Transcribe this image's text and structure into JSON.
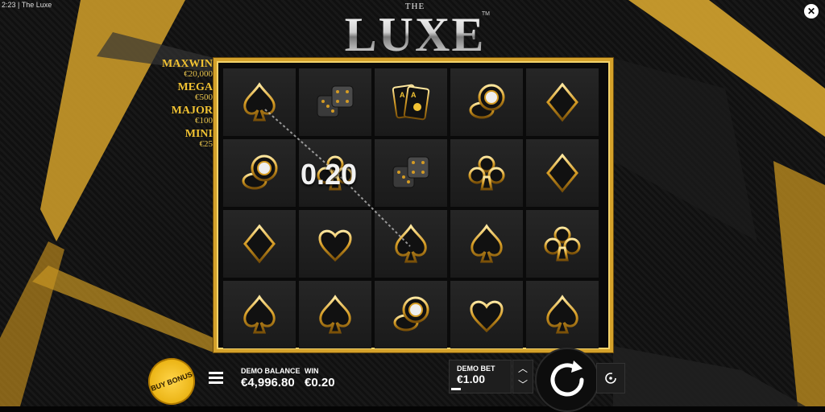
{
  "window": {
    "time": "2:23",
    "title": "The Luxe"
  },
  "logo": {
    "the": "THE",
    "name": "LUXE",
    "tm": "TM"
  },
  "jackpots": [
    {
      "name": "MAXWIN",
      "value": "€20,000"
    },
    {
      "name": "MEGA",
      "value": "€500"
    },
    {
      "name": "MAJOR",
      "value": "€100"
    },
    {
      "name": "MINI",
      "value": "€25"
    }
  ],
  "reels": [
    [
      "spade-icon",
      "dice-icon",
      "aces-cards-icon",
      "chips-icon",
      "diamond-icon"
    ],
    [
      "chips-icon",
      "club-icon",
      "dice-icon",
      "club-icon",
      "diamond-icon"
    ],
    [
      "diamond-icon",
      "heart-icon",
      "spade-icon",
      "spade-icon",
      "club-icon"
    ],
    [
      "spade-icon",
      "spade-icon",
      "chips-icon",
      "heart-icon",
      "spade-icon"
    ]
  ],
  "win_overlay": "0.20",
  "controls": {
    "buy_bonus": "BUY BONUS",
    "balance_label": "DEMO BALANCE",
    "balance": "€4,996.80",
    "win_label": "WIN",
    "win": "€0.20",
    "bet_label": "DEMO BET",
    "bet": "€1.00"
  },
  "colors": {
    "gold": "#d4a12a",
    "bg": "#050505"
  }
}
